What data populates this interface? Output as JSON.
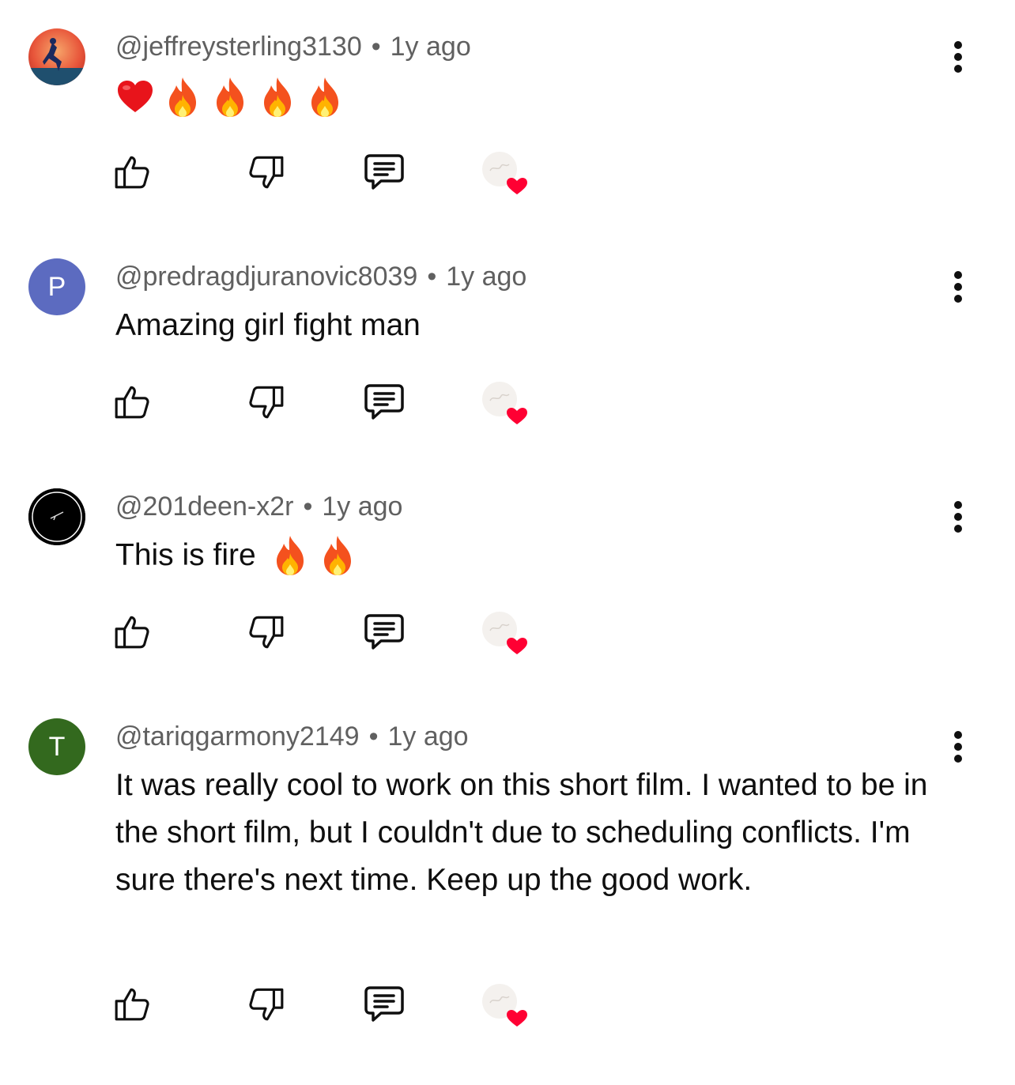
{
  "comments": [
    {
      "author": "@jeffreysterling3130",
      "time": "1y ago",
      "text": "",
      "emoji": [
        "red-heart",
        "fire",
        "fire",
        "fire",
        "fire"
      ],
      "avatar": {
        "type": "image",
        "letter": ""
      }
    },
    {
      "author": "@predragdjuranovic8039",
      "time": "1y ago",
      "text": "Amazing girl fight man",
      "avatar": {
        "type": "letter",
        "letter": "P",
        "color": "#5c6bc0"
      }
    },
    {
      "author": "@201deen-x2r",
      "time": "1y ago",
      "text": "This is fire",
      "emoji": [
        "fire",
        "fire"
      ],
      "avatar": {
        "type": "image",
        "letter": ""
      }
    },
    {
      "author": "@tariqgarmony2149",
      "time": "1y ago",
      "text": "It was really cool to work on this short film. I wanted to be in the short film, but I couldn't due to scheduling conflicts. I'm sure there's next time. Keep up the good work.",
      "avatar": {
        "type": "letter",
        "letter": "T",
        "color": "#33691e"
      }
    }
  ],
  "separator": "•",
  "colors": {
    "heart": "#ff0033",
    "meta": "#606060",
    "text": "#0f0f0f"
  },
  "icons": {
    "like": "thumbs-up-icon",
    "dislike": "thumbs-down-icon",
    "reply": "reply-icon",
    "creator_heart": "creator-heart-icon",
    "more": "more-vert-icon"
  }
}
